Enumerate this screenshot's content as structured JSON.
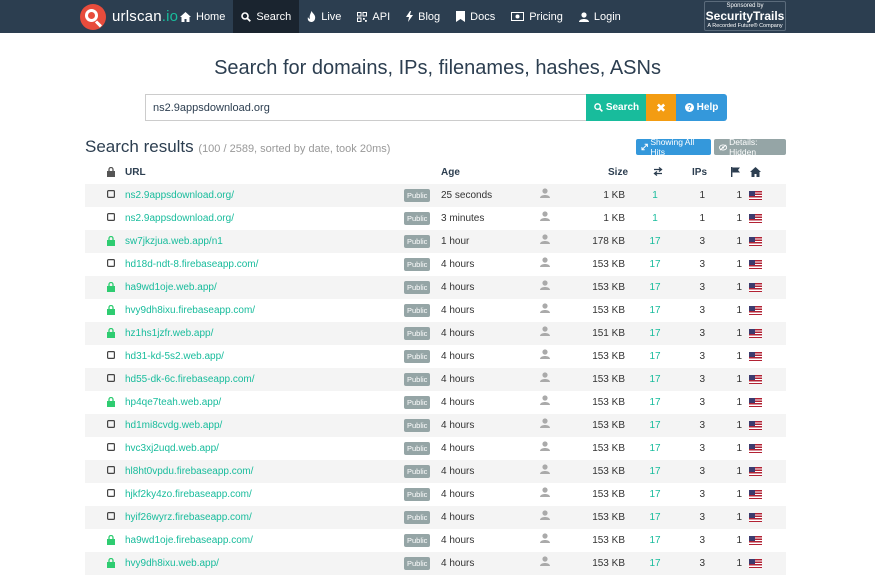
{
  "brand": {
    "name": "urlscan",
    "tld": ".io"
  },
  "nav": [
    {
      "label": "Home",
      "icon": "home-icon"
    },
    {
      "label": "Search",
      "icon": "search-icon",
      "active": true
    },
    {
      "label": "Live",
      "icon": "fire-icon"
    },
    {
      "label": "API",
      "icon": "qrcode-icon"
    },
    {
      "label": "Blog",
      "icon": "bolt-icon"
    },
    {
      "label": "Docs",
      "icon": "book-icon"
    },
    {
      "label": "Pricing",
      "icon": "money-icon"
    },
    {
      "label": "Login",
      "icon": "user-icon"
    }
  ],
  "sponsor": {
    "line1": "Sponsored by",
    "name": "SecurityTrails",
    "line3": "A Recorded Future® Company"
  },
  "heading": "Search for domains, IPs, filenames, hashes, ASNs",
  "search": {
    "value": "ns2.9appsdownload.org",
    "button_label": "Search",
    "clear_label": "✖",
    "help_label": "Help"
  },
  "results": {
    "title": "Search results",
    "meta": "(100 / 2589, sorted by date, took 20ms)",
    "showing_all_hits": "Showing All Hits",
    "details_hidden": "Details: Hidden"
  },
  "columns": {
    "url": "URL",
    "age": "Age",
    "size": "Size",
    "ips": "IPs"
  },
  "rows": [
    {
      "lock": false,
      "url": "ns2.9appsdownload.org/",
      "visibility": "Public",
      "age": "25 seconds",
      "size": "1 KB",
      "hits": "1",
      "ips": "1",
      "flags": "1"
    },
    {
      "lock": false,
      "url": "ns2.9appsdownload.org/",
      "visibility": "Public",
      "age": "3 minutes",
      "size": "1 KB",
      "hits": "1",
      "ips": "1",
      "flags": "1"
    },
    {
      "lock": true,
      "url": "sw7jkzjua.web.app/n1",
      "visibility": "Public",
      "age": "1 hour",
      "size": "178 KB",
      "hits": "17",
      "ips": "3",
      "flags": "1"
    },
    {
      "lock": false,
      "url": "hd18d-ndt-8.firebaseapp.com/",
      "visibility": "Public",
      "age": "4 hours",
      "size": "153 KB",
      "hits": "17",
      "ips": "3",
      "flags": "1"
    },
    {
      "lock": true,
      "url": "ha9wd1oje.web.app/",
      "visibility": "Public",
      "age": "4 hours",
      "size": "153 KB",
      "hits": "17",
      "ips": "3",
      "flags": "1"
    },
    {
      "lock": true,
      "url": "hvy9dh8ixu.firebaseapp.com/",
      "visibility": "Public",
      "age": "4 hours",
      "size": "153 KB",
      "hits": "17",
      "ips": "3",
      "flags": "1"
    },
    {
      "lock": true,
      "url": "hz1hs1jzfr.web.app/",
      "visibility": "Public",
      "age": "4 hours",
      "size": "151 KB",
      "hits": "17",
      "ips": "3",
      "flags": "1"
    },
    {
      "lock": false,
      "url": "hd31-kd-5s2.web.app/",
      "visibility": "Public",
      "age": "4 hours",
      "size": "153 KB",
      "hits": "17",
      "ips": "3",
      "flags": "1"
    },
    {
      "lock": false,
      "url": "hd55-dk-6c.firebaseapp.com/",
      "visibility": "Public",
      "age": "4 hours",
      "size": "153 KB",
      "hits": "17",
      "ips": "3",
      "flags": "1"
    },
    {
      "lock": true,
      "url": "hp4qe7teah.web.app/",
      "visibility": "Public",
      "age": "4 hours",
      "size": "153 KB",
      "hits": "17",
      "ips": "3",
      "flags": "1"
    },
    {
      "lock": false,
      "url": "hd1mi8cvdg.web.app/",
      "visibility": "Public",
      "age": "4 hours",
      "size": "153 KB",
      "hits": "17",
      "ips": "3",
      "flags": "1"
    },
    {
      "lock": false,
      "url": "hvc3xj2uqd.web.app/",
      "visibility": "Public",
      "age": "4 hours",
      "size": "153 KB",
      "hits": "17",
      "ips": "3",
      "flags": "1"
    },
    {
      "lock": false,
      "url": "hl8ht0vpdu.firebaseapp.com/",
      "visibility": "Public",
      "age": "4 hours",
      "size": "153 KB",
      "hits": "17",
      "ips": "3",
      "flags": "1"
    },
    {
      "lock": false,
      "url": "hjkf2ky4zo.firebaseapp.com/",
      "visibility": "Public",
      "age": "4 hours",
      "size": "153 KB",
      "hits": "17",
      "ips": "3",
      "flags": "1"
    },
    {
      "lock": false,
      "url": "hyif26wyrz.firebaseapp.com/",
      "visibility": "Public",
      "age": "4 hours",
      "size": "153 KB",
      "hits": "17",
      "ips": "3",
      "flags": "1"
    },
    {
      "lock": true,
      "url": "ha9wd1oje.firebaseapp.com/",
      "visibility": "Public",
      "age": "4 hours",
      "size": "153 KB",
      "hits": "17",
      "ips": "3",
      "flags": "1"
    },
    {
      "lock": true,
      "url": "hvy9dh8ixu.web.app/",
      "visibility": "Public",
      "age": "4 hours",
      "size": "153 KB",
      "hits": "17",
      "ips": "3",
      "flags": "1"
    }
  ],
  "colors": {
    "navbar": "#2c3e50",
    "accent": "#18bc9c",
    "warning": "#f39c12",
    "info": "#3498db",
    "badge": "#95a5a6"
  }
}
